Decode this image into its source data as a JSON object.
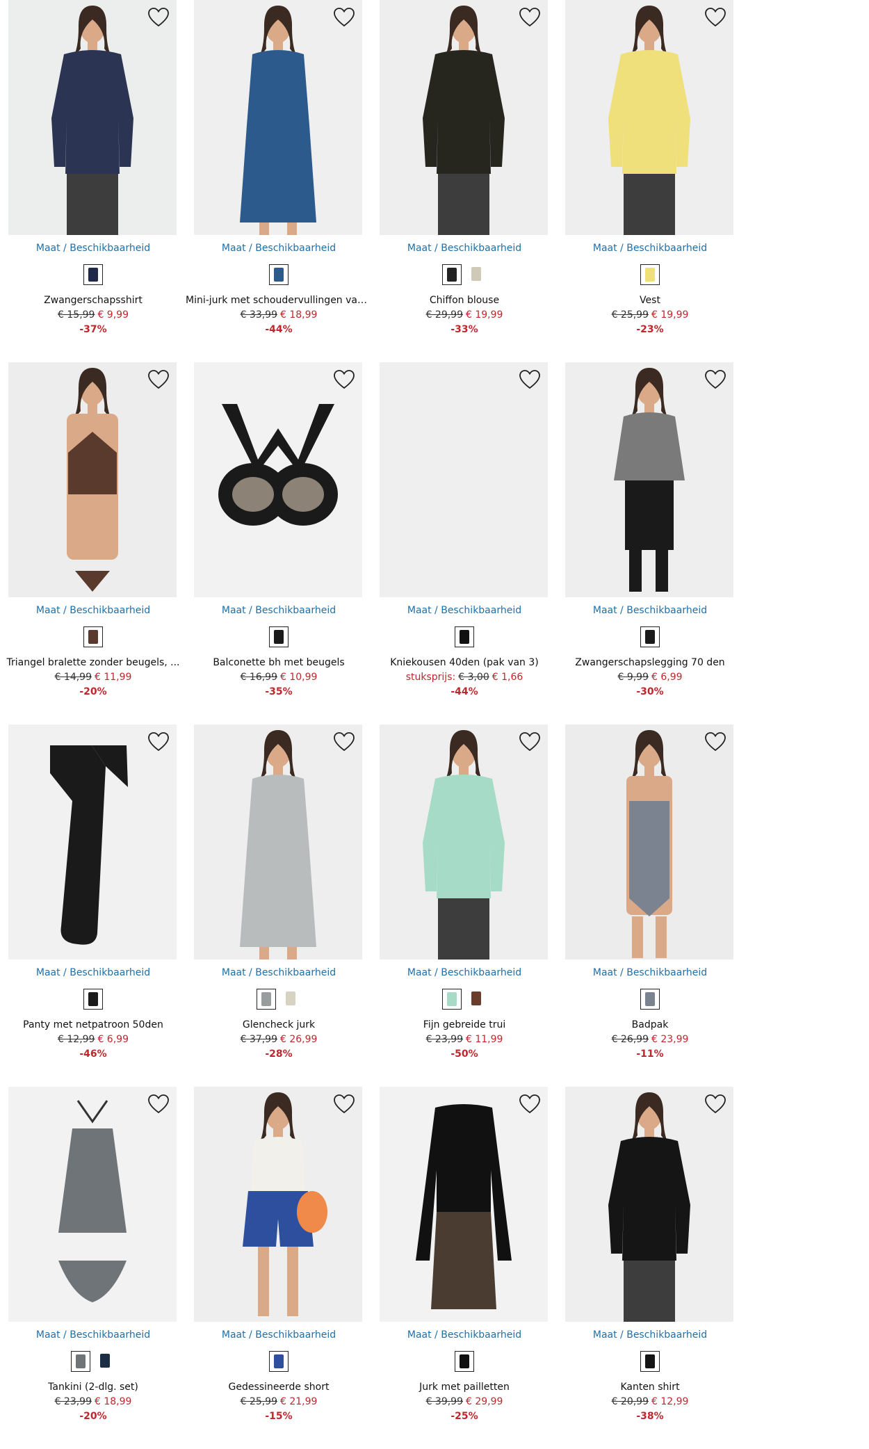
{
  "size_link_label": "Maat / Beschikbaarheid",
  "colors": {
    "price_red": "#c0272d",
    "link_blue": "#1f6fa8"
  },
  "products": [
    {
      "name": "Zwangerschapsshirt",
      "old_price": "€ 15,99",
      "new_price": "€ 9,99",
      "discount": "-37%",
      "unit_label": "",
      "figure": "top",
      "color": "#2b3452",
      "bg": "#eceded",
      "swatches": [
        "#1f2a4a"
      ]
    },
    {
      "name": "Mini-jurk met schoudervullingen van...",
      "old_price": "€ 33,99",
      "new_price": "€ 18,99",
      "discount": "-44%",
      "unit_label": "",
      "figure": "dress",
      "color": "#2c5a8c",
      "bg": "#efefef",
      "swatches": [
        "#2c5a8c"
      ]
    },
    {
      "name": "Chiffon blouse",
      "old_price": "€ 29,99",
      "new_price": "€ 19,99",
      "discount": "-33%",
      "unit_label": "",
      "figure": "top",
      "color": "#26261f",
      "bg": "#eeeeee",
      "swatches": [
        "#222222",
        "#cfcab8"
      ]
    },
    {
      "name": "Vest",
      "old_price": "€ 25,99",
      "new_price": "€ 19,99",
      "discount": "-23%",
      "unit_label": "",
      "figure": "top",
      "color": "#efe07c",
      "bg": "#eeeeee",
      "swatches": [
        "#efe07c"
      ]
    },
    {
      "name": "Triangel bralette zonder beugels, ...",
      "old_price": "€ 14,99",
      "new_price": "€ 11,99",
      "discount": "-20%",
      "unit_label": "",
      "figure": "bra",
      "color": "#5a3a2c",
      "bg": "#ededed",
      "swatches": [
        "#5a3a2c"
      ]
    },
    {
      "name": "Balconette bh met beugels",
      "old_price": "€ 16,99",
      "new_price": "€ 10,99",
      "discount": "-35%",
      "unit_label": "",
      "figure": "bra-flat",
      "color": "#1a1a1a",
      "bg": "#f2f2f2",
      "swatches": [
        "#1a1a1a"
      ]
    },
    {
      "name": "Kniekousen 40den (pak van 3)",
      "old_price": "€ 3,00",
      "new_price": "€ 1,66",
      "discount": "-44%",
      "unit_label": "stuksprijs:",
      "figure": "none",
      "color": "#111111",
      "bg": "#efefef",
      "swatches": [
        "#111111"
      ]
    },
    {
      "name": "Zwangerschapslegging 70 den",
      "old_price": "€ 9,99",
      "new_price": "€ 6,99",
      "discount": "-30%",
      "unit_label": "",
      "figure": "legging",
      "color": "#1a1a1a",
      "bg": "#eeeeee",
      "swatches": [
        "#1a1a1a"
      ]
    },
    {
      "name": "Panty met netpatroon 50den",
      "old_price": "€ 12,99",
      "new_price": "€ 6,99",
      "discount": "-46%",
      "unit_label": "",
      "figure": "tights",
      "color": "#1a1a1a",
      "bg": "#f1f1f1",
      "swatches": [
        "#1a1a1a"
      ]
    },
    {
      "name": "Glencheck jurk",
      "old_price": "€ 37,99",
      "new_price": "€ 26,99",
      "discount": "-28%",
      "unit_label": "",
      "figure": "dress",
      "color": "#b9bcbd",
      "bg": "#eeeeee",
      "swatches": [
        "#9a9d9e",
        "#d7d2c2"
      ]
    },
    {
      "name": "Fijn gebreide trui",
      "old_price": "€ 23,99",
      "new_price": "€ 11,99",
      "discount": "-50%",
      "unit_label": "",
      "figure": "top",
      "color": "#a5dbc7",
      "bg": "#eeeeee",
      "swatches": [
        "#a5dbc7",
        "#6b3b2c"
      ]
    },
    {
      "name": "Badpak",
      "old_price": "€ 26,99",
      "new_price": "€ 23,99",
      "discount": "-11%",
      "unit_label": "",
      "figure": "swimsuit",
      "color": "#7c8390",
      "bg": "#ececec",
      "swatches": [
        "#7c8390"
      ]
    },
    {
      "name": "Tankini (2-dlg. set)",
      "old_price": "€ 23,99",
      "new_price": "€ 18,99",
      "discount": "-20%",
      "unit_label": "",
      "figure": "tankini",
      "color": "#6f7478",
      "bg": "#f2f2f2",
      "swatches": [
        "#6f7478",
        "#1c2e44"
      ]
    },
    {
      "name": "Gedessineerde short",
      "old_price": "€ 25,99",
      "new_price": "€ 21,99",
      "discount": "-15%",
      "unit_label": "",
      "figure": "short",
      "color": "#2d4f9e",
      "bg": "#eeeeee",
      "swatches": [
        "#2d4f9e"
      ]
    },
    {
      "name": "Jurk met pailletten",
      "old_price": "€ 39,99",
      "new_price": "€ 29,99",
      "discount": "-25%",
      "unit_label": "",
      "figure": "sequin",
      "color": "#111111",
      "bg": "#f2f2f2",
      "swatches": [
        "#111111"
      ]
    },
    {
      "name": "Kanten shirt",
      "old_price": "€ 20,99",
      "new_price": "€ 12,99",
      "discount": "-38%",
      "unit_label": "",
      "figure": "top",
      "color": "#151515",
      "bg": "#eeeeee",
      "swatches": [
        "#151515"
      ]
    }
  ]
}
